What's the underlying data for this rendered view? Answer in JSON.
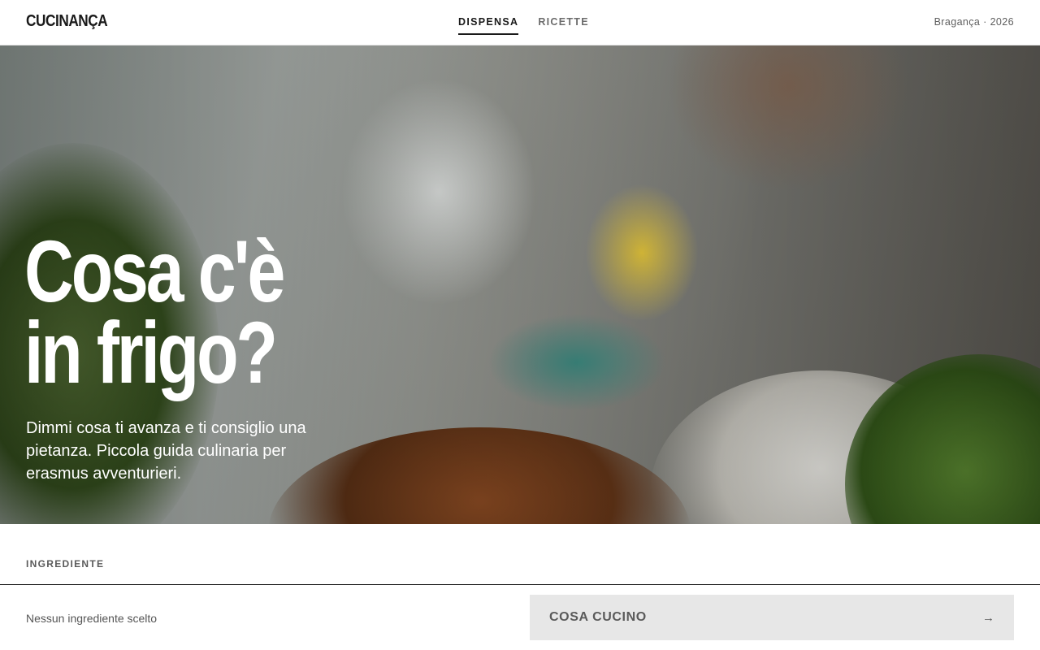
{
  "header": {
    "logo": "CUCINANÇA",
    "tabs": [
      {
        "label": "DISPENSA",
        "active": true
      },
      {
        "label": "RICETTE",
        "active": false
      }
    ],
    "location": "Bragança · 2026"
  },
  "hero": {
    "headline_line1": "Cosa c'è",
    "headline_line2": "in frigo?",
    "subtitle": "Dimmi cosa ti avanza e ti consiglio una pietanza. Piccola guida culinaria per erasmus avventurieri."
  },
  "ingredients": {
    "section_label": "INGREDIENTE",
    "selection_status": "Nessun ingrediente scelto",
    "cook_button_label": "COSA CUCINO",
    "cook_button_icon": "→"
  },
  "colors": {
    "text": "#1a1a1a",
    "muted": "#6b6b6b",
    "button_bg": "#e7e7e7"
  }
}
